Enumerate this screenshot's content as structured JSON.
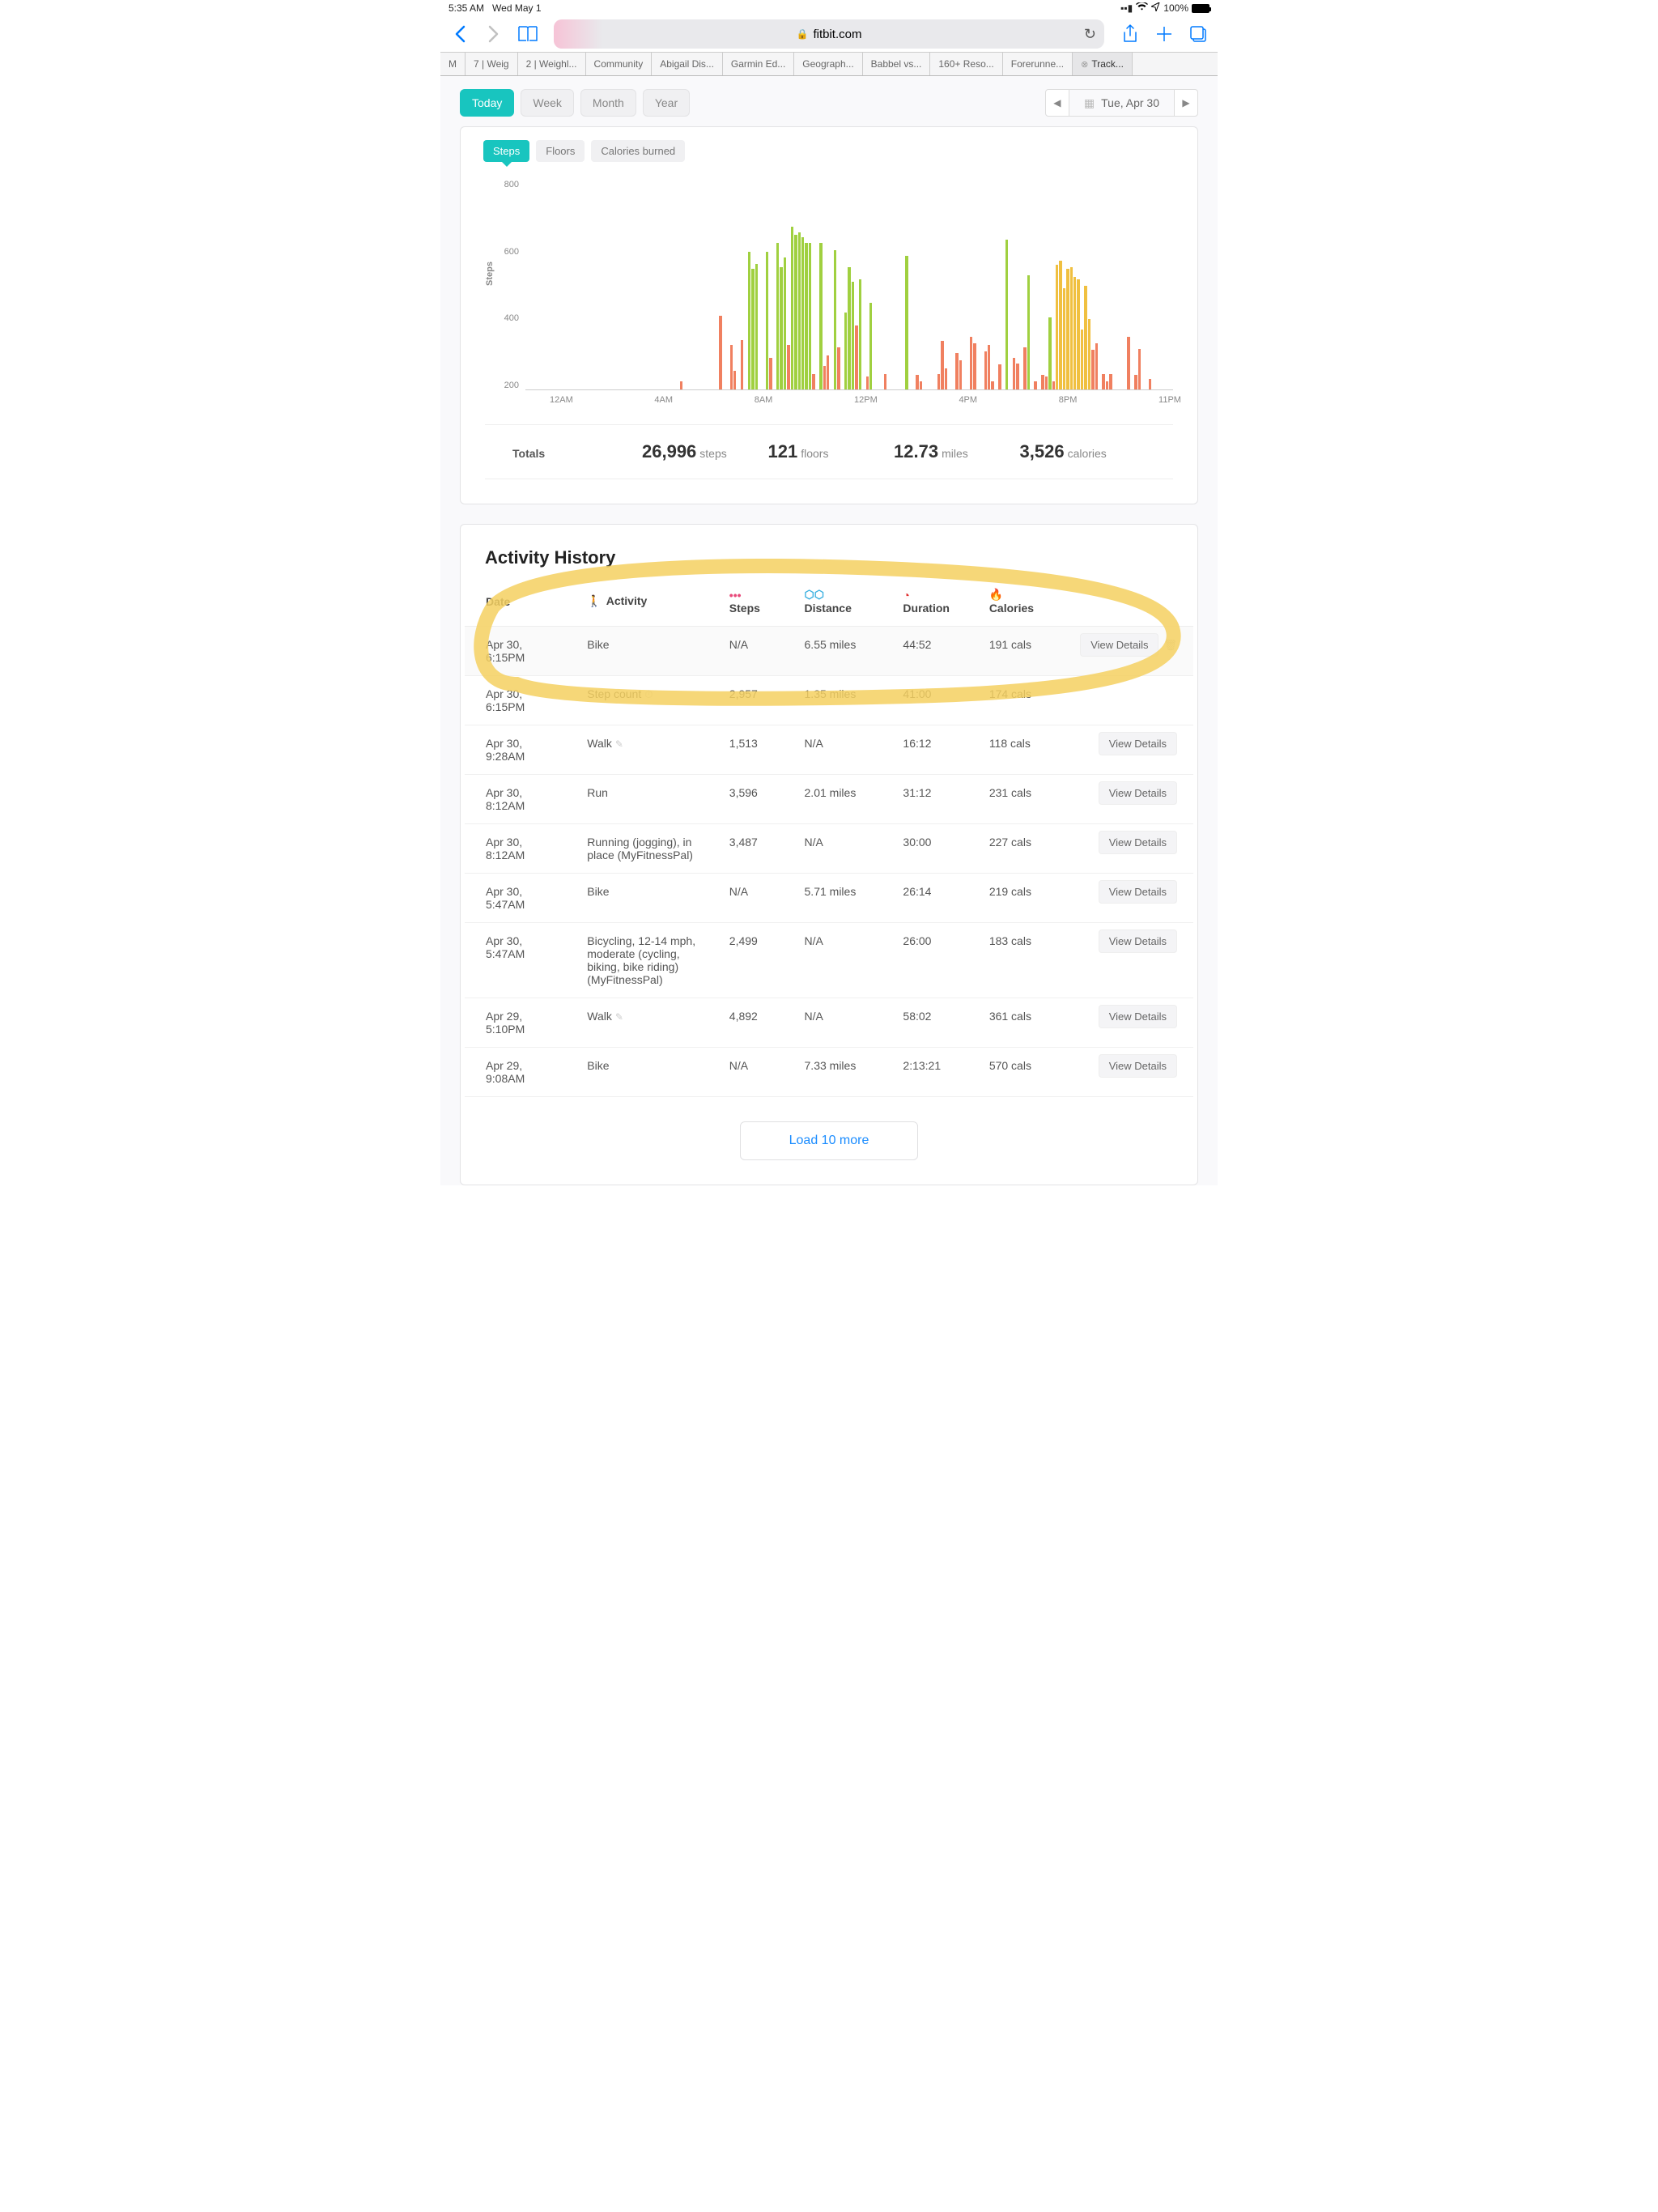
{
  "status_bar": {
    "time": "5:35 AM",
    "date": "Wed May 1",
    "battery_pct": "100%"
  },
  "browser": {
    "url_host": "fitbit.com",
    "tabs": [
      {
        "label": "M"
      },
      {
        "label": "7 | Weig"
      },
      {
        "label": "2 | Weighl..."
      },
      {
        "label": "Community"
      },
      {
        "label": "Abigail Dis..."
      },
      {
        "label": "Garmin Ed..."
      },
      {
        "label": "Geograph..."
      },
      {
        "label": "Babbel vs..."
      },
      {
        "label": "160+ Reso..."
      },
      {
        "label": "Forerunne..."
      },
      {
        "label": "Track...",
        "active": true
      }
    ]
  },
  "range": {
    "tabs": [
      "Today",
      "Week",
      "Month",
      "Year"
    ],
    "active_idx": 0,
    "date_display": "Tue, Apr 30"
  },
  "metrics": {
    "tabs": [
      "Steps",
      "Floors",
      "Calories burned"
    ],
    "active_idx": 0
  },
  "chart_data": {
    "type": "bar",
    "ylabel": "Steps",
    "ylim": [
      0,
      800
    ],
    "y_ticks": [
      "800",
      "600",
      "400",
      "200"
    ],
    "x_ticks": [
      "12AM",
      "4AM",
      "8AM",
      "12PM",
      "4PM",
      "8PM",
      "11PM"
    ],
    "values": [
      0,
      0,
      0,
      0,
      0,
      0,
      0,
      0,
      0,
      0,
      0,
      0,
      0,
      0,
      0,
      0,
      0,
      0,
      0,
      0,
      0,
      0,
      0,
      0,
      0,
      0,
      0,
      0,
      0,
      0,
      0,
      0,
      0,
      0,
      0,
      0,
      0,
      0,
      0,
      0,
      0,
      0,
      0,
      30,
      0,
      0,
      0,
      0,
      0,
      0,
      0,
      0,
      0,
      0,
      280,
      0,
      0,
      170,
      70,
      0,
      190,
      0,
      525,
      460,
      480,
      0,
      0,
      525,
      120,
      0,
      560,
      465,
      505,
      170,
      620,
      590,
      600,
      580,
      560,
      560,
      60,
      0,
      560,
      90,
      130,
      0,
      530,
      160,
      0,
      295,
      465,
      410,
      245,
      420,
      0,
      50,
      330,
      0,
      0,
      0,
      60,
      0,
      0,
      0,
      0,
      0,
      510,
      0,
      0,
      55,
      30,
      0,
      0,
      0,
      0,
      60,
      185,
      80,
      0,
      0,
      140,
      110,
      0,
      0,
      200,
      175,
      0,
      0,
      145,
      170,
      30,
      0,
      95,
      0,
      570,
      0,
      120,
      100,
      0,
      160,
      435,
      0,
      30,
      0,
      55,
      50,
      275,
      30,
      475,
      490,
      385,
      460,
      465,
      430,
      420,
      230,
      395,
      270,
      150,
      175,
      0,
      60,
      30,
      60,
      0,
      0,
      0,
      0,
      200,
      0,
      55,
      155,
      0,
      0,
      40,
      0,
      0,
      0,
      0,
      0,
      0
    ],
    "colors": [
      0,
      0,
      0,
      0,
      0,
      0,
      0,
      0,
      0,
      0,
      0,
      0,
      0,
      0,
      0,
      0,
      0,
      0,
      0,
      0,
      0,
      0,
      0,
      0,
      0,
      0,
      0,
      0,
      0,
      0,
      0,
      0,
      0,
      0,
      0,
      0,
      0,
      0,
      0,
      0,
      0,
      0,
      0,
      0,
      0,
      0,
      0,
      0,
      0,
      0,
      0,
      0,
      0,
      0,
      0,
      0,
      0,
      0,
      0,
      0,
      0,
      0,
      1,
      1,
      1,
      0,
      0,
      1,
      0,
      0,
      1,
      1,
      1,
      0,
      1,
      1,
      1,
      1,
      1,
      1,
      0,
      0,
      1,
      0,
      0,
      0,
      1,
      0,
      0,
      1,
      1,
      1,
      0,
      1,
      0,
      0,
      1,
      0,
      0,
      0,
      0,
      0,
      0,
      0,
      0,
      0,
      1,
      0,
      0,
      0,
      0,
      0,
      0,
      0,
      0,
      0,
      0,
      0,
      0,
      0,
      0,
      0,
      0,
      0,
      0,
      0,
      0,
      0,
      0,
      0,
      0,
      0,
      0,
      0,
      1,
      0,
      0,
      0,
      0,
      0,
      1,
      0,
      0,
      0,
      0,
      0,
      1,
      0,
      2,
      2,
      2,
      2,
      2,
      2,
      2,
      2,
      2,
      2,
      0,
      0,
      0,
      0,
      0,
      0,
      0,
      0,
      0,
      0,
      0,
      0,
      0,
      0,
      0,
      0,
      0,
      0,
      0,
      0,
      0,
      0,
      0
    ],
    "palette": [
      "#f08060",
      "#a0d040",
      "#f0c040"
    ]
  },
  "totals": {
    "label": "Totals",
    "steps_val": "26,996",
    "steps_unit": "steps",
    "floors_val": "121",
    "floors_unit": "floors",
    "miles_val": "12.73",
    "miles_unit": "miles",
    "cals_val": "3,526",
    "cals_unit": "calories"
  },
  "history": {
    "title": "Activity History",
    "load_more": "Load 10 more",
    "view_details": "View Details",
    "headers": {
      "date": "Date",
      "activity": "Activity",
      "steps": "Steps",
      "distance": "Distance",
      "duration": "Duration",
      "calories": "Calories"
    },
    "rows": [
      {
        "date": "Apr 30, 6:15PM",
        "activity": "Bike",
        "steps": "N/A",
        "distance": "6.55 miles",
        "duration": "44:52",
        "calories": "191 cals",
        "btn": true,
        "trash": true,
        "hover": true
      },
      {
        "date": "Apr 30, 6:15PM",
        "activity": "Step count",
        "sw": true,
        "steps": "2,957",
        "distance": "1.35 miles",
        "duration": "41:00",
        "calories": "174 cals"
      },
      {
        "date": "Apr 30, 9:28AM",
        "activity": "Walk",
        "pencil": true,
        "steps": "1,513",
        "distance": "N/A",
        "duration": "16:12",
        "calories": "118 cals",
        "btn": true
      },
      {
        "date": "Apr 30, 8:12AM",
        "activity": "Run",
        "steps": "3,596",
        "distance": "2.01 miles",
        "duration": "31:12",
        "calories": "231 cals",
        "btn": true
      },
      {
        "date": "Apr 30, 8:12AM",
        "activity": "Running (jogging), in place (MyFitnessPal)",
        "steps": "3,487",
        "distance": "N/A",
        "duration": "30:00",
        "calories": "227 cals",
        "btn": true
      },
      {
        "date": "Apr 30, 5:47AM",
        "activity": "Bike",
        "steps": "N/A",
        "distance": "5.71 miles",
        "duration": "26:14",
        "calories": "219 cals",
        "btn": true
      },
      {
        "date": "Apr 30, 5:47AM",
        "activity": "Bicycling, 12-14 mph, moderate (cycling, biking, bike riding) (MyFitnessPal)",
        "steps": "2,499",
        "distance": "N/A",
        "duration": "26:00",
        "calories": "183 cals",
        "btn": true
      },
      {
        "date": "Apr 29, 5:10PM",
        "activity": "Walk",
        "pencil": true,
        "steps": "4,892",
        "distance": "N/A",
        "duration": "58:02",
        "calories": "361 cals",
        "btn": true
      },
      {
        "date": "Apr 29, 9:08AM",
        "activity": "Bike",
        "steps": "N/A",
        "distance": "7.33 miles",
        "duration": "2:13:21",
        "calories": "570 cals",
        "btn": true
      }
    ]
  }
}
